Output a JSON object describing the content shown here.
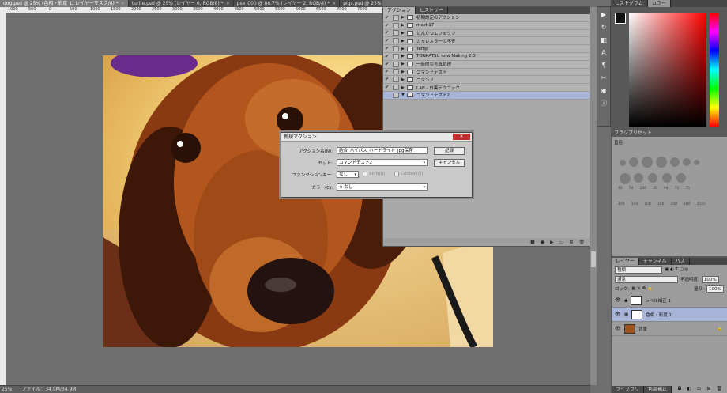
{
  "doc_tabs": [
    {
      "label": "dog.psd @ 25% (色相・彩度 1, レイヤーマスク/8) *",
      "active": true
    },
    {
      "label": "turtle.psd @ 25% (レイヤー 0, RGB/8) *",
      "active": false
    },
    {
      "label": "pse_000 @ 86.7% (レイヤー 2, RGB/8) *",
      "active": false
    },
    {
      "label": "pigs.psd @ 25% (レイヤー 0, RGB/8) *",
      "active": false
    }
  ],
  "ruler": {
    "ticks": [
      "1000",
      "500",
      "0",
      "500",
      "1000",
      "1500",
      "2000",
      "2500",
      "3000",
      "3500",
      "4000",
      "4500",
      "5000",
      "5500",
      "6000",
      "6500",
      "7000",
      "7500"
    ]
  },
  "actions_panel": {
    "tabs": [
      "アクション",
      "ヒストリー"
    ],
    "rows": [
      {
        "label": "初期設定のアクション",
        "checked": true
      },
      {
        "label": "mach17",
        "checked": true
      },
      {
        "label": "とんかつエフェクツ",
        "checked": true
      },
      {
        "label": "カモレスラーの不安",
        "checked": true
      },
      {
        "label": "Temp",
        "checked": true
      },
      {
        "label": "TONKATSU now Making 2.0",
        "checked": true
      },
      {
        "label": "一時的な写真処理",
        "checked": true
      },
      {
        "label": "コマンドテスト",
        "checked": true
      },
      {
        "label": "コマンド",
        "checked": true
      },
      {
        "label": "LAB - 白黒テクニック",
        "checked": true
      },
      {
        "label": "コマンドテスト2",
        "checked": false,
        "selected": true
      }
    ]
  },
  "new_action_dialog": {
    "title": "新規アクション",
    "name_label": "アクション名(N):",
    "name_value": "結合_ハイパス_ハードライト_jpg保存",
    "set_label": "セット:",
    "set_value": "コマンドテスト2",
    "fkey_label": "ファンクションキー:",
    "fkey_value": "なし",
    "shift_label": "Shift(S)",
    "control_label": "Control(O)",
    "color_label": "カラー(C):",
    "color_value": "なし",
    "color_prefix": "×",
    "record_button": "記録",
    "cancel_button": "キャンセル"
  },
  "color_panel": {
    "tabs": [
      "ヒストグラム",
      "カラー"
    ]
  },
  "brush_panel": {
    "title": "ブラシプリセット",
    "size_label": "直径:",
    "sizes": [
      "42",
      "74",
      "100",
      "35",
      "94",
      "75",
      "75",
      "100",
      "100",
      "100",
      "100",
      "100",
      "100",
      "2555"
    ]
  },
  "layers_panel": {
    "tabs": [
      "レイヤー",
      "チャンネル",
      "パス"
    ],
    "filter": "種類",
    "blend_mode": "通常",
    "opacity_label": "不透明度:",
    "opacity_value": "100%",
    "lock_label": "ロック:",
    "fill_label": "塗り:",
    "fill_value": "100%",
    "layers": [
      {
        "name": "レベル補正 1",
        "selected": false
      },
      {
        "name": "色相・彩度 1",
        "selected": true
      },
      {
        "name": "背景",
        "selected": false
      }
    ]
  },
  "statusbar": {
    "zoom": "25%",
    "file_info": "ファイル：34.9M/34.9M"
  },
  "bottom_tabs": [
    "ライブラリ",
    "色調補正"
  ]
}
